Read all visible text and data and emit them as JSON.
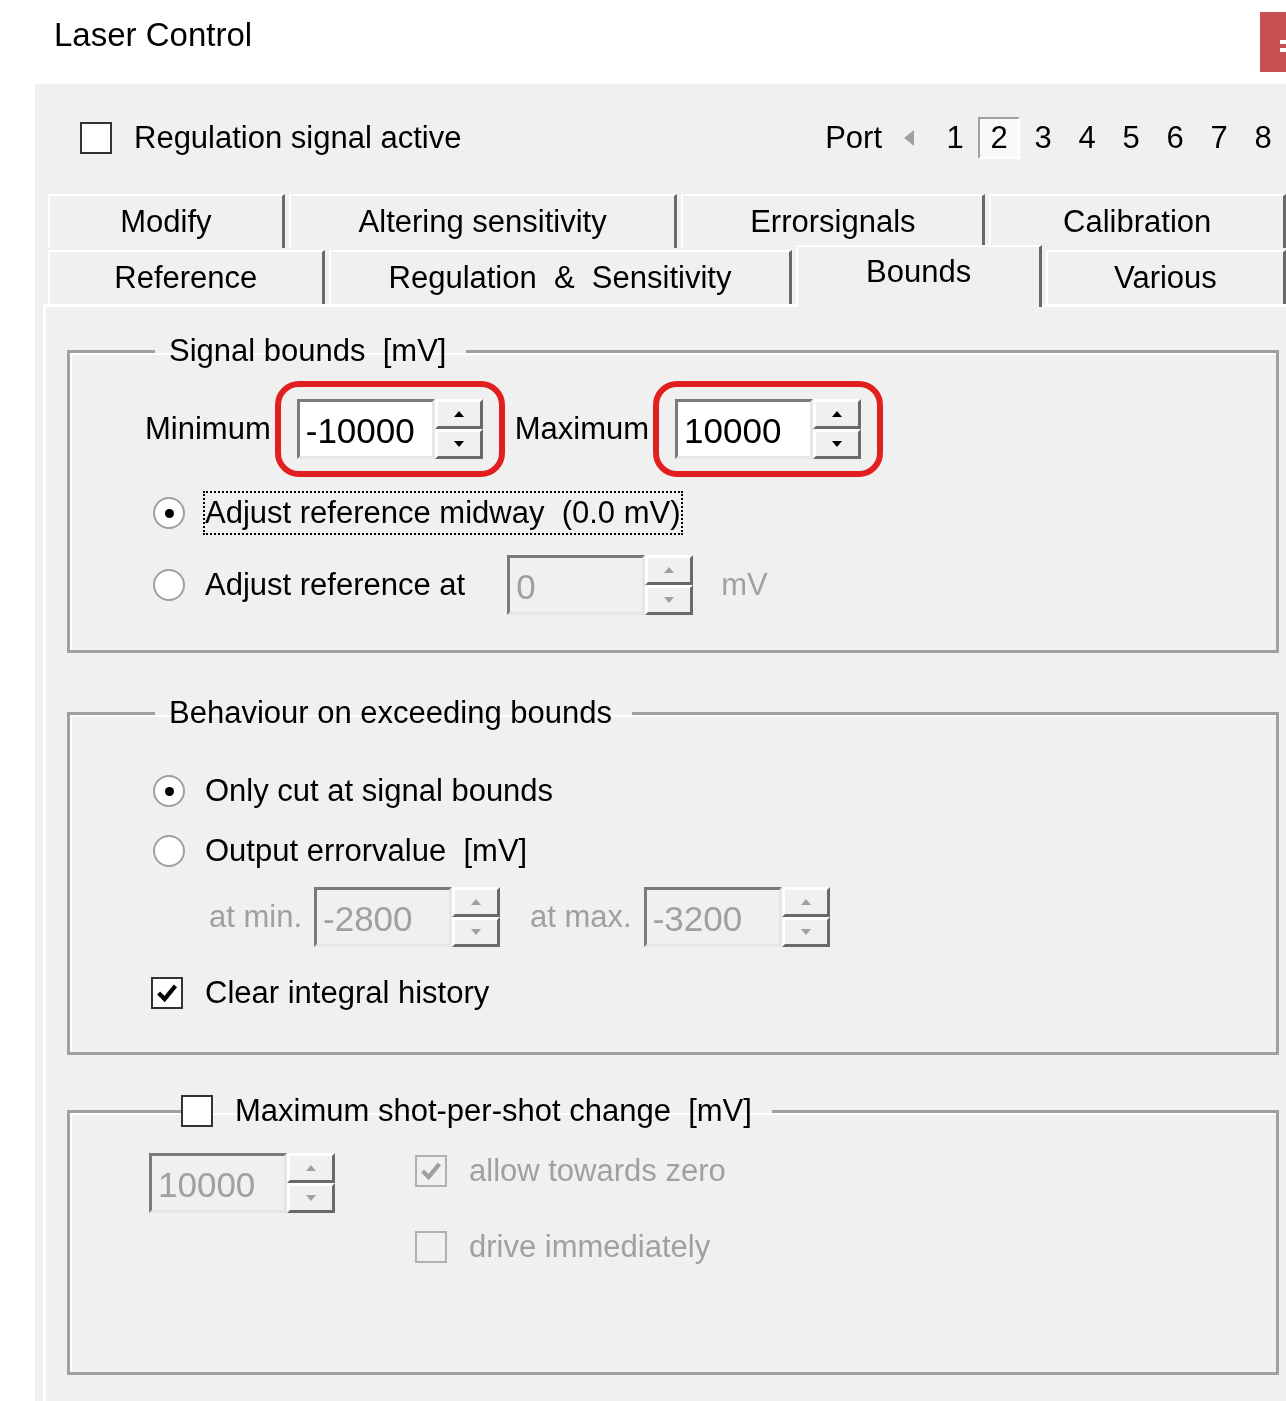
{
  "window": {
    "title": "Laser Control"
  },
  "regulation_active": {
    "label": "Regulation signal active",
    "checked": false
  },
  "port": {
    "label": "Port",
    "items": [
      {
        "label": "1",
        "selected": false
      },
      {
        "label": "2",
        "selected": true
      },
      {
        "label": "3",
        "selected": false
      },
      {
        "label": "4",
        "selected": false
      },
      {
        "label": "5",
        "selected": false
      },
      {
        "label": "6",
        "selected": false
      },
      {
        "label": "7",
        "selected": false
      },
      {
        "label": "8",
        "selected": false
      }
    ]
  },
  "tabs": {
    "rows": [
      [
        {
          "label": "Modify",
          "selected": false
        },
        {
          "label": "Altering sensitivity",
          "selected": false
        },
        {
          "label": "Errorsignals",
          "selected": false
        },
        {
          "label": "Calibration",
          "selected": false
        }
      ],
      [
        {
          "label": "Reference",
          "selected": false
        },
        {
          "label": "Regulation  &  Sensitivity",
          "selected": false
        },
        {
          "label": "Bounds",
          "selected": true
        },
        {
          "label": "Various",
          "selected": false
        }
      ]
    ]
  },
  "signal_bounds": {
    "title": "Signal bounds  [mV]",
    "limits": [
      {
        "label": "Minimum",
        "value": "-10000",
        "highlighted": true,
        "disabled": false
      },
      {
        "label": "Maximum",
        "value": "10000",
        "highlighted": true,
        "disabled": false
      }
    ],
    "options": [
      {
        "label": "Adjust reference midway  (0.0 mV)",
        "selected": true,
        "focused": true
      },
      {
        "label": "Adjust reference at",
        "selected": false,
        "focused": false,
        "field": {
          "value": "0",
          "disabled": true
        },
        "unit": "mV"
      }
    ]
  },
  "behaviour": {
    "title": "Behaviour on exceeding bounds",
    "options": [
      {
        "label": "Only cut at signal bounds",
        "selected": true
      },
      {
        "label": "Output errorvalue  [mV]",
        "selected": false
      }
    ],
    "error_fields": [
      {
        "label": "at min.",
        "value": "-2800",
        "disabled": true
      },
      {
        "label": "at max.",
        "value": "-3200",
        "disabled": true
      }
    ],
    "clear_history": {
      "label": "Clear integral history",
      "checked": true,
      "disabled": false
    }
  },
  "shot_change": {
    "title": "Maximum shot-per-shot change  [mV]",
    "checked": false,
    "field": {
      "value": "10000",
      "disabled": true
    },
    "options": [
      {
        "label": "allow towards zero",
        "checked": true,
        "disabled": true
      },
      {
        "label": "drive immediately",
        "checked": false,
        "disabled": true
      }
    ]
  }
}
